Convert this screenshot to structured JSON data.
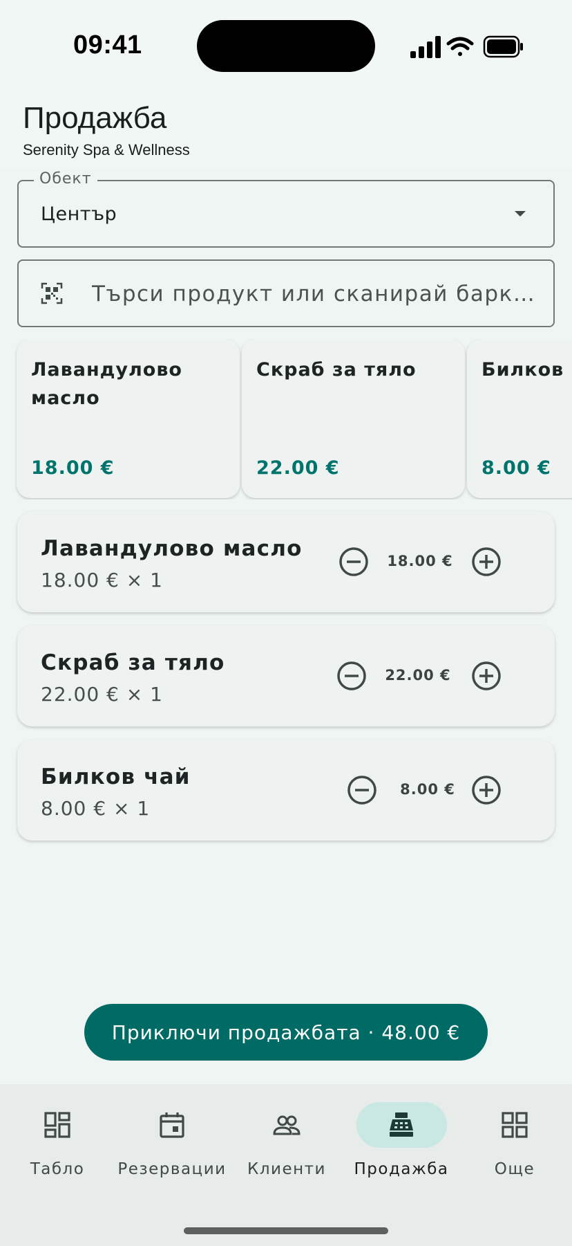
{
  "status_bar": {
    "time": "09:41"
  },
  "header": {
    "title": "Продажба",
    "subtitle": "Serenity Spa & Wellness"
  },
  "location_select": {
    "label": "Обект",
    "value": "Център"
  },
  "search": {
    "placeholder": "Търси продукт или сканирай барк…",
    "icon": "qr-code-scan-icon"
  },
  "products": [
    {
      "name": "Лавандулово масло",
      "price": "18.00 €"
    },
    {
      "name": "Скраб за тяло",
      "price": "22.00 €"
    },
    {
      "name": "Билков чай",
      "price": "8.00 €"
    }
  ],
  "cart": [
    {
      "name": "Лавандулово масло",
      "detail": "18.00 € × 1",
      "total": "18.00 €"
    },
    {
      "name": "Скраб за тяло",
      "detail": "22.00 € × 1",
      "total": "22.00 €"
    },
    {
      "name": "Билков чай",
      "detail": "8.00 € × 1",
      "total": "8.00 €"
    }
  ],
  "checkout": {
    "label": "Приключи продажбата · 48.00 €"
  },
  "nav": {
    "items": [
      {
        "label": "Табло",
        "icon": "dashboard-icon"
      },
      {
        "label": "Резервации",
        "icon": "calendar-icon"
      },
      {
        "label": "Клиенти",
        "icon": "people-icon"
      },
      {
        "label": "Продажба",
        "icon": "cash-register-icon",
        "active": true
      },
      {
        "label": "Още",
        "icon": "grid-icon"
      }
    ]
  },
  "colors": {
    "primary": "#006a64",
    "price": "#00746c",
    "active_indicator": "#c9e7e3",
    "background": "#eff5f3"
  }
}
